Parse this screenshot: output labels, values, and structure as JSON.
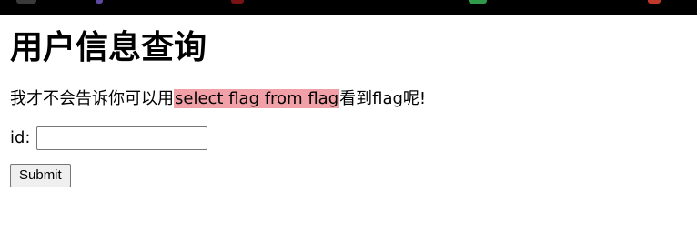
{
  "title": "用户信息查询",
  "hint": {
    "prefix": "我才不会告诉你可以用",
    "highlight": "select flag from flag",
    "suffix": "看到flag呢!"
  },
  "form": {
    "id_label": "id:",
    "id_value": "",
    "submit_label": "Submit"
  },
  "colors": {
    "highlight": "#f0a0a6",
    "top_strip": "#000000"
  }
}
